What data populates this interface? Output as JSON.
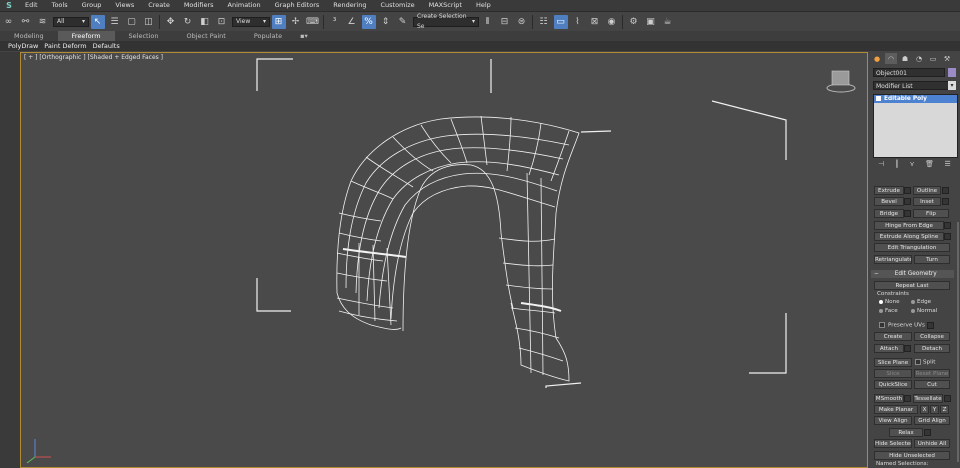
{
  "menu": {
    "items": [
      "Edit",
      "Tools",
      "Group",
      "Views",
      "Create",
      "Modifiers",
      "Animation",
      "Graph Editors",
      "Rendering",
      "Customize",
      "MAXScript",
      "Help"
    ]
  },
  "toolbar": {
    "selection_filter": "All",
    "ref_coord": "View",
    "named_selection": "Create Selection Se"
  },
  "ribbon": {
    "tabs": [
      "Modeling",
      "Freeform",
      "Selection",
      "Object Paint",
      "Populate"
    ],
    "active_tab": "Freeform",
    "subtabs": [
      "PolyDraw",
      "Paint Deform",
      "Defaults"
    ]
  },
  "viewport": {
    "label": "[ + ] [Orthographic ] [Shaded + Edged Faces ]"
  },
  "panel": {
    "object_name": "Object001",
    "modifier_list": "Modifier List",
    "stack_item": "Editable Poly",
    "buttons": {
      "extrude": "Extrude",
      "outline": "Outline",
      "bevel": "Bevel",
      "inset": "Inset",
      "bridge": "Bridge",
      "flip": "Flip",
      "hinge": "Hinge From Edge",
      "extrude_spline": "Extrude Along Spline",
      "edit_tri": "Edit Triangulation",
      "retri": "Retriangulate",
      "turn": "Turn"
    },
    "edit_geometry": {
      "title": "Edit Geometry",
      "repeat_last": "Repeat Last",
      "constraints": "Constraints",
      "c_none": "None",
      "c_edge": "Edge",
      "c_face": "Face",
      "c_normal": "Normal",
      "preserve_uvs": "Preserve UVs",
      "create": "Create",
      "collapse": "Collapse",
      "attach": "Attach",
      "detach": "Detach",
      "slice_plane": "Slice Plane",
      "split": "Split",
      "slice": "Slice",
      "reset_plane": "Reset Plane",
      "quickslice": "QuickSlice",
      "cut": "Cut",
      "msmooth": "MSmooth",
      "tessellate": "Tessellate",
      "make_planar": "Make Planar",
      "x": "X",
      "y": "Y",
      "z": "Z",
      "view_align": "View Align",
      "grid_align": "Grid Align",
      "relax": "Relax",
      "hide_selected": "Hide Selected",
      "unhide_all": "Unhide All",
      "hide_unselected": "Hide Unselected",
      "named_selections": "Named Selections:"
    }
  }
}
